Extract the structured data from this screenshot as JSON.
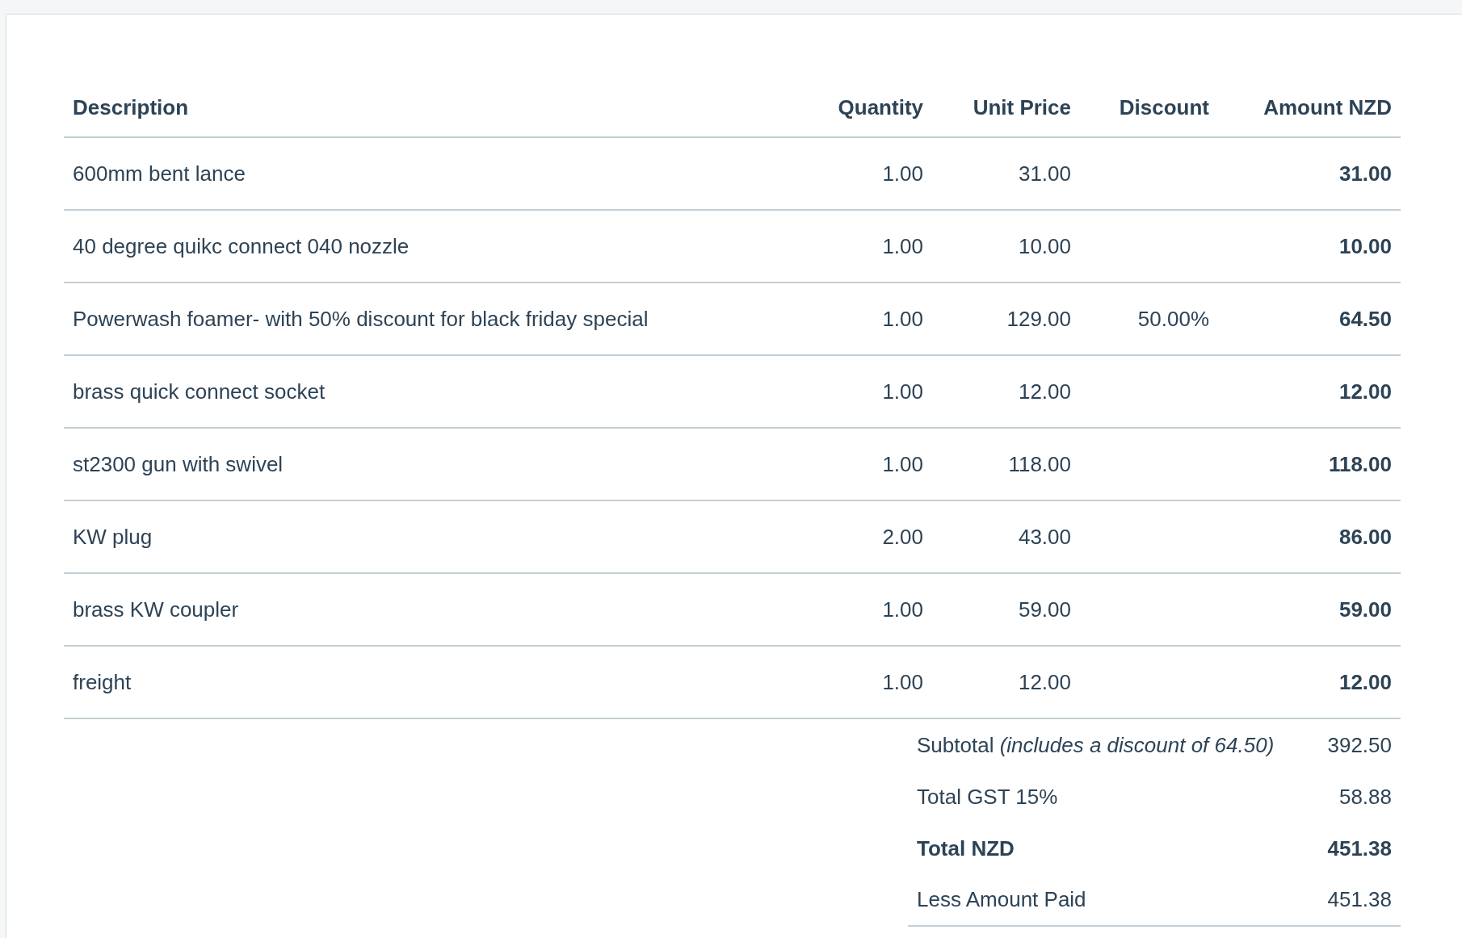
{
  "table": {
    "columns": [
      "Description",
      "Quantity",
      "Unit Price",
      "Discount",
      "Amount NZD"
    ],
    "rows": [
      {
        "description": "600mm bent lance",
        "quantity": "1.00",
        "unit_price": "31.00",
        "amount": "31.00"
      },
      {
        "description": "40 degree quikc connect 040 nozzle",
        "quantity": "1.00",
        "unit_price": "10.00",
        "amount": "10.00"
      },
      {
        "description": "Powerwash foamer- with 50% discount for black friday special",
        "quantity": "1.00",
        "unit_price": "129.00",
        "discount": "50.00%",
        "amount": "64.50"
      },
      {
        "description": "brass quick connect socket",
        "quantity": "1.00",
        "unit_price": "12.00",
        "amount": "12.00"
      },
      {
        "description": "st2300 gun with swivel",
        "quantity": "1.00",
        "unit_price": "118.00",
        "amount": "118.00"
      },
      {
        "description": "KW plug",
        "quantity": "2.00",
        "unit_price": "43.00",
        "amount": "86.00"
      },
      {
        "description": "brass KW coupler",
        "quantity": "1.00",
        "unit_price": "59.00",
        "amount": "59.00"
      },
      {
        "description": "freight",
        "quantity": "1.00",
        "unit_price": "12.00",
        "amount": "12.00"
      }
    ]
  },
  "totals": [
    {
      "kind": "line",
      "label": "Subtotal *(includes a discount of 64.50)*",
      "value": "392.50"
    },
    {
      "kind": "line",
      "label": "Total GST 15%",
      "value": "58.88"
    },
    {
      "kind": "total",
      "label": "Total NZD",
      "value": "451.38"
    },
    {
      "kind": "paid",
      "label": "Less Amount Paid",
      "value": "451.38"
    }
  ]
}
